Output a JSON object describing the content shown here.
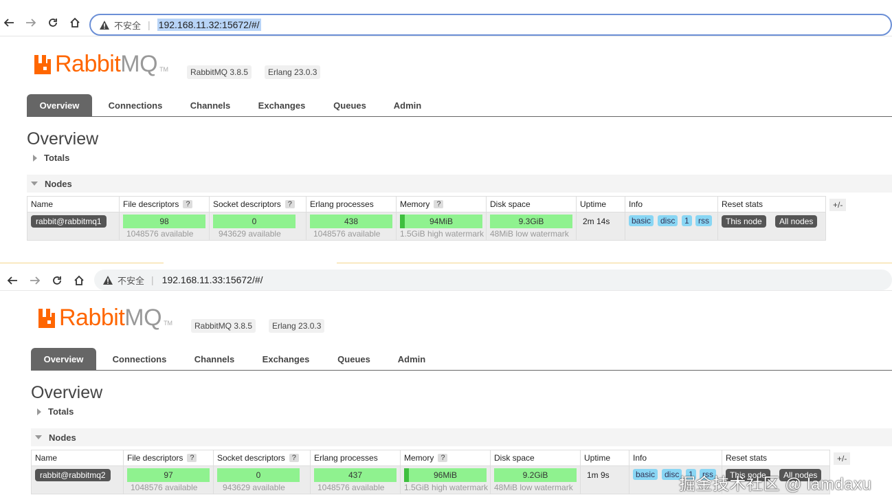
{
  "frames": [
    {
      "browser": {
        "insecure": "不安全",
        "url": "192.168.11.32:15672/#/"
      },
      "logo": {
        "word": "Rabbit",
        "mq": "MQ",
        "tm": "TM"
      },
      "versions": [
        "RabbitMQ 3.8.5",
        "Erlang 23.0.3"
      ],
      "tabs": [
        "Overview",
        "Connections",
        "Channels",
        "Exchanges",
        "Queues",
        "Admin"
      ],
      "title": "Overview",
      "totals": "Totals",
      "nodes": "Nodes",
      "headers": {
        "name": "Name",
        "fd": "File descriptors",
        "sd": "Socket descriptors",
        "ep": "Erlang processes",
        "mem": "Memory",
        "disk": "Disk space",
        "uptime": "Uptime",
        "info": "Info",
        "reset": "Reset stats",
        "q": "?",
        "pm": "+/-"
      },
      "row": {
        "name": "rabbit@rabbitmq1",
        "fd": "98",
        "fd_sub": "1048576 available",
        "sd": "0",
        "sd_sub": "943629 available",
        "ep": "438",
        "ep_sub": "1048576 available",
        "mem": "94MiB",
        "mem_sub": "1.5GiB high watermark",
        "mem_fill": 0.06,
        "disk": "9.3GiB",
        "disk_sub": "48MiB low watermark",
        "uptime": "2m 14s",
        "info": [
          "basic",
          "disc",
          "1",
          "rss"
        ],
        "reset": [
          "This node",
          "All nodes"
        ]
      }
    },
    {
      "browser": {
        "insecure": "不安全",
        "url": "192.168.11.33:15672/#/"
      },
      "logo": {
        "word": "Rabbit",
        "mq": "MQ",
        "tm": "TM"
      },
      "versions": [
        "RabbitMQ 3.8.5",
        "Erlang 23.0.3"
      ],
      "tabs": [
        "Overview",
        "Connections",
        "Channels",
        "Exchanges",
        "Queues",
        "Admin"
      ],
      "title": "Overview",
      "totals": "Totals",
      "nodes": "Nodes",
      "headers": {
        "name": "Name",
        "fd": "File descriptors",
        "sd": "Socket descriptors",
        "ep": "Erlang processes",
        "mem": "Memory",
        "disk": "Disk space",
        "uptime": "Uptime",
        "info": "Info",
        "reset": "Reset stats",
        "q": "?",
        "pm": "+/-"
      },
      "row": {
        "name": "rabbit@rabbitmq2",
        "fd": "97",
        "fd_sub": "1048576 available",
        "sd": "0",
        "sd_sub": "943629 available",
        "ep": "437",
        "ep_sub": "1048576 available",
        "mem": "96MiB",
        "mem_sub": "1.5GiB high watermark",
        "mem_fill": 0.06,
        "disk": "9.2GiB",
        "disk_sub": "48MiB low watermark",
        "uptime": "1m 9s",
        "info": [
          "basic",
          "disc",
          "1",
          "rss"
        ],
        "reset": [
          "This node",
          "All nodes"
        ]
      }
    }
  ],
  "watermark": "掘金技术社区 @ lamdaxu",
  "colors": {
    "brand_orange": "#ff6600",
    "bar_green": "#8ff28f",
    "tag_blue": "#89d6f4",
    "tab_active": "#666666"
  }
}
